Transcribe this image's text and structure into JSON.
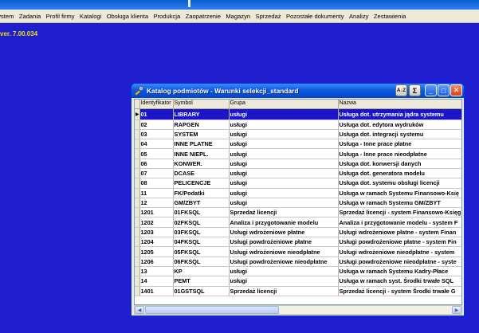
{
  "menu": [
    "ystem",
    "Zadania",
    "Profil firmy",
    "Katalogi",
    "Obsługa klienta",
    "Produkcja",
    "Zaopatrzenie",
    "Magazyn",
    "Sprzedaż",
    "Pozostałe dokumenty",
    "Analizy",
    "Zestawienia"
  ],
  "version": "ver. 7.00.034",
  "window": {
    "title": "Katalog podmiotów - Warunki selekcji_standard",
    "sort_icon_label": "A↓Z",
    "sum_icon_label": "Σ",
    "minimize_label": "_",
    "maximize_label": "□",
    "close_label": "✕"
  },
  "table": {
    "columns": [
      "Identyfikator",
      "Symbol",
      "Grupa",
      "Nazwa"
    ],
    "selected_row": 0,
    "rows": [
      [
        "01",
        "LIBRARY",
        "usługi",
        "Usługa dot. utrzymania jądra systemu"
      ],
      [
        "02",
        "RAPGEN",
        "usługi",
        "Usługa dot. edytora wydruków"
      ],
      [
        "03",
        "SYSTEM",
        "usługi",
        "Usługa dot. integracji systemu"
      ],
      [
        "04",
        "INNE PLATNE",
        "usługi",
        "Usługa - Inne prace płatne"
      ],
      [
        "05",
        "INNE NIEPL.",
        "usługi",
        "Usługa - Inne prace nieodpłatne"
      ],
      [
        "06",
        "KONWER.",
        "usługi",
        "Usługa dot. konwersji danych"
      ],
      [
        "07",
        "DCASE",
        "usługi",
        "Usługa dot. generatora modelu"
      ],
      [
        "08",
        "PELICENCJE",
        "usługi",
        "Usługa dot. systemu obsługi licencji"
      ],
      [
        "11",
        "FK/Podatki",
        "usługi",
        "Usługa w ramach Systemu Finansowo-Księ"
      ],
      [
        "12",
        "GM/ZBYT",
        "usługi",
        "Usługa w ramach Systemu GM/ZBYT"
      ],
      [
        "1201",
        "01FKSQL",
        "Sprzedaż licencji",
        "Sprzedaż licencji - system Finansowo-Księg"
      ],
      [
        "1202",
        "02FKSQL",
        "Analiza i przygotowanie modelu",
        "Analiza i przygotowanie modelu - system F"
      ],
      [
        "1203",
        "03FKSQL",
        "Usługi wdrożeniowe płatne",
        "Usługi wdrożeniowe płatne - system Finan"
      ],
      [
        "1204",
        "04FKSQL",
        "Usługi powdrożeniowe płatne",
        "Usługi powdrożeniowe płatne - system Fin"
      ],
      [
        "1205",
        "05FKSQL",
        "Usługi wdrożeniowe nieodpłatne",
        "Usługi wdrożeniowe nieodpłatne - system"
      ],
      [
        "1206",
        "06FKSQL",
        "Usługi powdrożeniowe nieodpłatne",
        "Usługi powdrożeniowe nieodpłatne - syste"
      ],
      [
        "13",
        "KP",
        "usługi",
        "Usługa w ramach Systemu Kadry-Płace"
      ],
      [
        "14",
        "PEMT",
        "usługi",
        "Usługa w ramach syst. Środki trwałe SQL"
      ],
      [
        "1401",
        "01GSTSQL",
        "Sprzedaż licencji",
        "Sprzedaż licencji - system Środki trwałe G"
      ]
    ]
  },
  "colors": {
    "desktop": "#1f1fd0",
    "selection": "#1b14c8",
    "version_text": "#e8e000"
  }
}
